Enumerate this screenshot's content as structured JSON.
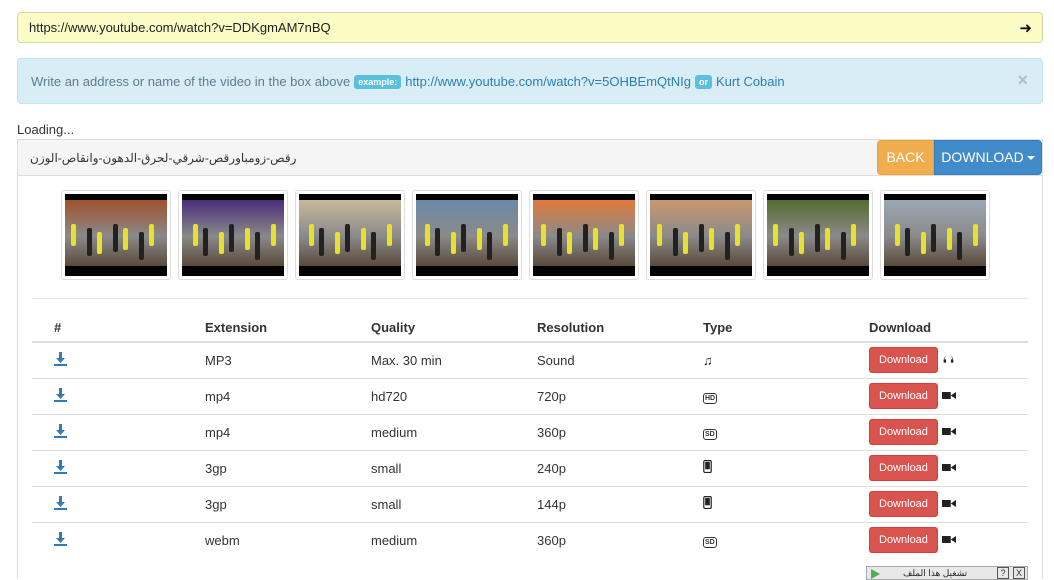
{
  "url_bar": {
    "value": "https://www.youtube.com/watch?v=DDKgmAM7nBQ",
    "go_icon": "arrow-right-icon"
  },
  "alert": {
    "text": "Write an address or name of the video in the box above",
    "badge_example": "example:",
    "example_link": "http://www.youtube.com/watch?v=5OHBEmQtNIg",
    "badge_or": "or",
    "example_name": "Kurt Cobain",
    "close": "×"
  },
  "status": {
    "loading": "Loading..."
  },
  "video": {
    "title": "رقص-زومباورقص-شرقي-لحرق-الدهون-وانقاص-الوزن",
    "back_label": "BACK",
    "download_label": "DOWNLOAD"
  },
  "thumbnails": [
    {
      "color": "#a0522d"
    },
    {
      "color": "#4a2d7a"
    },
    {
      "color": "#c8b89a"
    },
    {
      "color": "#6b8aa8"
    },
    {
      "color": "#e07a3a"
    },
    {
      "color": "#c99870"
    },
    {
      "color": "#556b2f"
    },
    {
      "color": "#9aa7b5"
    }
  ],
  "table": {
    "headers": [
      "#",
      "Extension",
      "Quality",
      "Resolution",
      "Type",
      "Download"
    ],
    "rows": [
      {
        "ext": "MP3",
        "quality": "Max. 30 min",
        "res": "Sound",
        "type_icon": "music-note-icon",
        "btn": "Download",
        "dl_icon": "headphones-icon"
      },
      {
        "ext": "mp4",
        "quality": "hd720",
        "res": "720p",
        "type_icon": "hd-icon",
        "btn": "Download",
        "dl_icon": "video-camera-icon"
      },
      {
        "ext": "mp4",
        "quality": "medium",
        "res": "360p",
        "type_icon": "sd-icon",
        "btn": "Download",
        "dl_icon": "video-camera-icon"
      },
      {
        "ext": "3gp",
        "quality": "small",
        "res": "240p",
        "type_icon": "mobile-icon",
        "btn": "Download",
        "dl_icon": "video-camera-icon"
      },
      {
        "ext": "3gp",
        "quality": "small",
        "res": "144p",
        "type_icon": "mobile-icon",
        "btn": "Download",
        "dl_icon": "video-camera-icon"
      },
      {
        "ext": "webm",
        "quality": "medium",
        "res": "360p",
        "type_icon": "sd-icon",
        "btn": "Download",
        "dl_icon": "video-camera-icon"
      }
    ]
  },
  "ad": {
    "label": "تشغيل هذا الملف",
    "help": "?",
    "close": "X"
  },
  "colors": {
    "accent": "#428bca",
    "back": "#f0ad4e",
    "download_btn": "#d9534f",
    "url_bg": "#fbfbc6",
    "alert_bg": "#d9edf7"
  }
}
